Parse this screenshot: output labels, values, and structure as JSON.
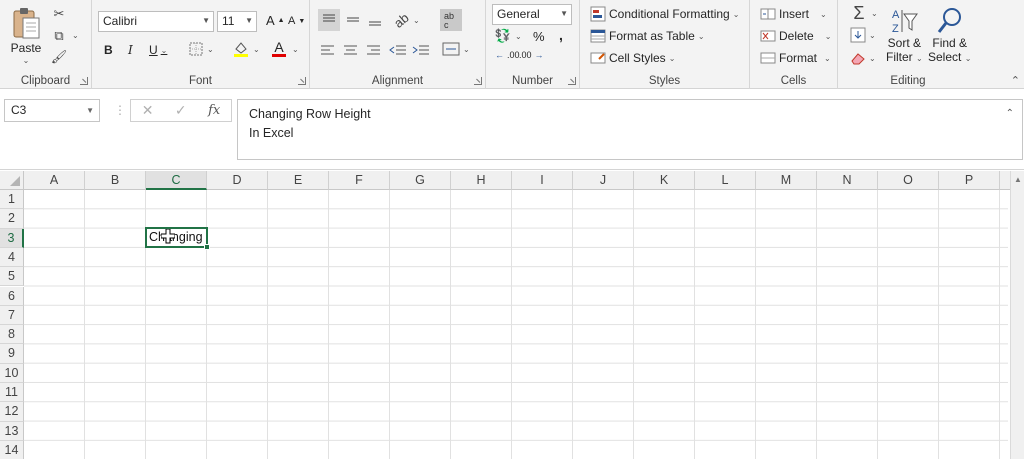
{
  "ribbon": {
    "clipboard": {
      "label": "Clipboard",
      "paste": "Paste"
    },
    "font": {
      "label": "Font",
      "font_name": "Calibri",
      "font_size": "11",
      "grow": "A",
      "shrink": "A",
      "bold": "B",
      "italic": "I",
      "underline": "U",
      "font_color": "A"
    },
    "alignment": {
      "label": "Alignment"
    },
    "number": {
      "label": "Number",
      "format": "General",
      "percent": "%",
      "comma": ",",
      "inc_decimal": ".00",
      "dec_decimal": ".00"
    },
    "styles": {
      "label": "Styles",
      "conditional": "Conditional Formatting",
      "format_table": "Format as Table",
      "cell_styles": "Cell Styles"
    },
    "cells": {
      "label": "Cells",
      "insert": "Insert",
      "delete": "Delete",
      "format": "Format"
    },
    "editing": {
      "label": "Editing",
      "sort_filter_1": "Sort &",
      "sort_filter_2": "Filter",
      "find_select_1": "Find &",
      "find_select_2": "Select"
    }
  },
  "formula_bar": {
    "name_box": "C3",
    "fx": "fx",
    "content_line1": "Changing Row Height",
    "content_line2": "In Excel"
  },
  "sheet": {
    "columns": [
      "A",
      "B",
      "C",
      "D",
      "E",
      "F",
      "G",
      "H",
      "I",
      "J",
      "K",
      "L",
      "M",
      "N",
      "O",
      "P"
    ],
    "rows": [
      "1",
      "2",
      "3",
      "4",
      "5",
      "6",
      "7",
      "8",
      "9",
      "10",
      "11",
      "12",
      "13",
      "14"
    ],
    "selected_column": "C",
    "selected_row": "3",
    "active_cell_text": "Changing"
  },
  "colors": {
    "accent": "#217346",
    "ribbon_bg": "#f3f3f3",
    "header_bg": "#f0f0f0"
  }
}
